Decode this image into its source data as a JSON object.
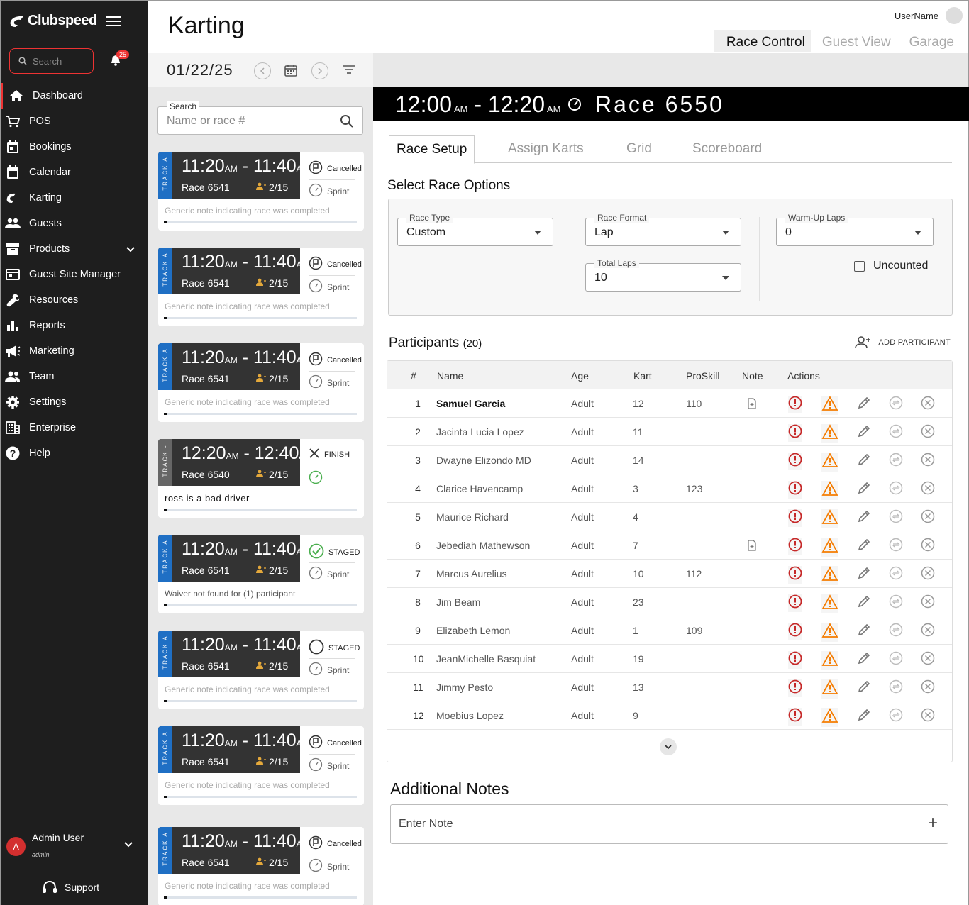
{
  "sidebar": {
    "logo": "Clubspeed",
    "search_placeholder": "Search",
    "notif_count": "25",
    "items": [
      {
        "label": "Dashboard",
        "icon": "home-icon"
      },
      {
        "label": "POS",
        "icon": "cart-icon"
      },
      {
        "label": "Bookings",
        "icon": "calendar-check-icon"
      },
      {
        "label": "Calendar",
        "icon": "calendar-icon"
      },
      {
        "label": "Karting",
        "icon": "karting-icon"
      },
      {
        "label": "Guests",
        "icon": "people-icon"
      },
      {
        "label": "Products",
        "icon": "archive-icon"
      },
      {
        "label": "Guest Site Manager",
        "icon": "site-icon"
      },
      {
        "label": "Resources",
        "icon": "wrench-icon"
      },
      {
        "label": "Reports",
        "icon": "bar-chart-icon"
      },
      {
        "label": "Marketing",
        "icon": "megaphone-icon"
      },
      {
        "label": "Team",
        "icon": "team-icon"
      },
      {
        "label": "Settings",
        "icon": "gear-icon"
      },
      {
        "label": "Enterprise",
        "icon": "building-icon"
      },
      {
        "label": "Help",
        "icon": "help-icon"
      }
    ],
    "user": {
      "initial": "A",
      "name": "Admin User",
      "role": "admin"
    },
    "support": "Support"
  },
  "header": {
    "title": "Karting",
    "username": "UserName",
    "tabs": [
      "Race Control",
      "Guest View",
      "Garage"
    ]
  },
  "list": {
    "date": "01/22/25",
    "search_label": "Search",
    "search_placeholder": "Name or race #",
    "cards": [
      {
        "track": "TRACK A",
        "start": "11:20",
        "end": "11:40",
        "ampm": "AM",
        "race": "Race 6541",
        "count": "2/15",
        "status": "Cancelled",
        "type": "Sprint",
        "note": "Generic note indicating race was completed"
      },
      {
        "track": "TRACK A",
        "start": "11:20",
        "end": "11:40",
        "ampm": "AM",
        "race": "Race 6541",
        "count": "2/15",
        "status": "Cancelled",
        "type": "Sprint",
        "note": "Generic note indicating race was completed"
      },
      {
        "track": "TRACK A",
        "start": "11:20",
        "end": "11:40",
        "ampm": "AM",
        "race": "Race 6541",
        "count": "2/15",
        "status": "Cancelled",
        "type": "Sprint",
        "note": "Generic note indicating race was completed"
      },
      {
        "track": "TRACK -",
        "start": "12:20",
        "end": "12:40",
        "ampm": "AM",
        "race": "Race 6540",
        "count": "2/15",
        "status": "FINISH",
        "type": "",
        "note": "ross is a bad driver"
      },
      {
        "track": "TRACK A",
        "start": "11:20",
        "end": "11:40",
        "ampm": "AM",
        "race": "Race 6541",
        "count": "2/15",
        "status": "STAGED",
        "type": "Sprint",
        "note": "Waiver not found for (1) participant"
      },
      {
        "track": "TRACK A",
        "start": "11:20",
        "end": "11:40",
        "ampm": "AM",
        "race": "Race 6541",
        "count": "2/15",
        "status": "STAGED",
        "type": "Sprint",
        "note": "Generic note indicating race was completed"
      },
      {
        "track": "TRACK A",
        "start": "11:20",
        "end": "11:40",
        "ampm": "AM",
        "race": "Race 6541",
        "count": "2/15",
        "status": "Cancelled",
        "type": "Sprint",
        "note": "Generic note indicating race was completed"
      },
      {
        "track": "TRACK A",
        "start": "11:20",
        "end": "11:40",
        "ampm": "AM",
        "race": "Race 6541",
        "count": "2/15",
        "status": "Cancelled",
        "type": "Sprint",
        "note": "Generic note indicating race was completed"
      }
    ]
  },
  "race": {
    "start": "12:00",
    "end": "12:20",
    "ampm": "AM",
    "name": "Race 6550",
    "tabs": [
      "Race Setup",
      "Assign Karts",
      "Grid",
      "Scoreboard"
    ],
    "options_title": "Select Race Options",
    "race_type": {
      "label": "Race Type",
      "value": "Custom"
    },
    "race_format": {
      "label": "Race Format",
      "value": "Lap"
    },
    "total_laps": {
      "label": "Total Laps",
      "value": "10"
    },
    "warmup_laps": {
      "label": "Warm-Up Laps",
      "value": "0"
    },
    "uncounted": "Uncounted",
    "participants_title": "Participants",
    "participants_count": "(20)",
    "add_participant": "ADD PARTICIPANT",
    "columns": [
      "#",
      "Name",
      "Age",
      "Kart",
      "ProSkill",
      "Note",
      "Actions"
    ],
    "participants": [
      {
        "n": "1",
        "name": "Samuel Garcia",
        "age": "Adult",
        "kart": "12",
        "proskill": "110",
        "note": true
      },
      {
        "n": "2",
        "name": "Jacinta Lucia Lopez",
        "age": "Adult",
        "kart": "11",
        "proskill": "",
        "note": false
      },
      {
        "n": "3",
        "name": "Dwayne Elizondo MD",
        "age": "Adult",
        "kart": "14",
        "proskill": "",
        "note": false
      },
      {
        "n": "4",
        "name": "Clarice Havencamp",
        "age": "Adult",
        "kart": "3",
        "proskill": "123",
        "note": false
      },
      {
        "n": "5",
        "name": "Maurice Richard",
        "age": "Adult",
        "kart": "4",
        "proskill": "",
        "note": false
      },
      {
        "n": "6",
        "name": "Jebediah Mathewson",
        "age": "Adult",
        "kart": "7",
        "proskill": "",
        "note": true
      },
      {
        "n": "7",
        "name": "Marcus Aurelius",
        "age": "Adult",
        "kart": "10",
        "proskill": "112",
        "note": false
      },
      {
        "n": "8",
        "name": "Jim Beam",
        "age": "Adult",
        "kart": "23",
        "proskill": "",
        "note": false
      },
      {
        "n": "9",
        "name": "Elizabeth Lemon",
        "age": "Adult",
        "kart": "1",
        "proskill": "109",
        "note": false
      },
      {
        "n": "10",
        "name": "JeanMichelle Basquiat",
        "age": "Adult",
        "kart": "19",
        "proskill": "",
        "note": false
      },
      {
        "n": "11",
        "name": "Jimmy Pesto",
        "age": "Adult",
        "kart": "13",
        "proskill": "",
        "note": false
      },
      {
        "n": "12",
        "name": "Moebius Lopez",
        "age": "Adult",
        "kart": "9",
        "proskill": "",
        "note": false
      }
    ],
    "notes_title": "Additional Notes",
    "notes_placeholder": "Enter Note"
  },
  "colors": {
    "accent": "#e53935",
    "track": "#1f6fc4",
    "warn": "#f57c00",
    "error": "#c62828",
    "staged": "#4caf50"
  }
}
